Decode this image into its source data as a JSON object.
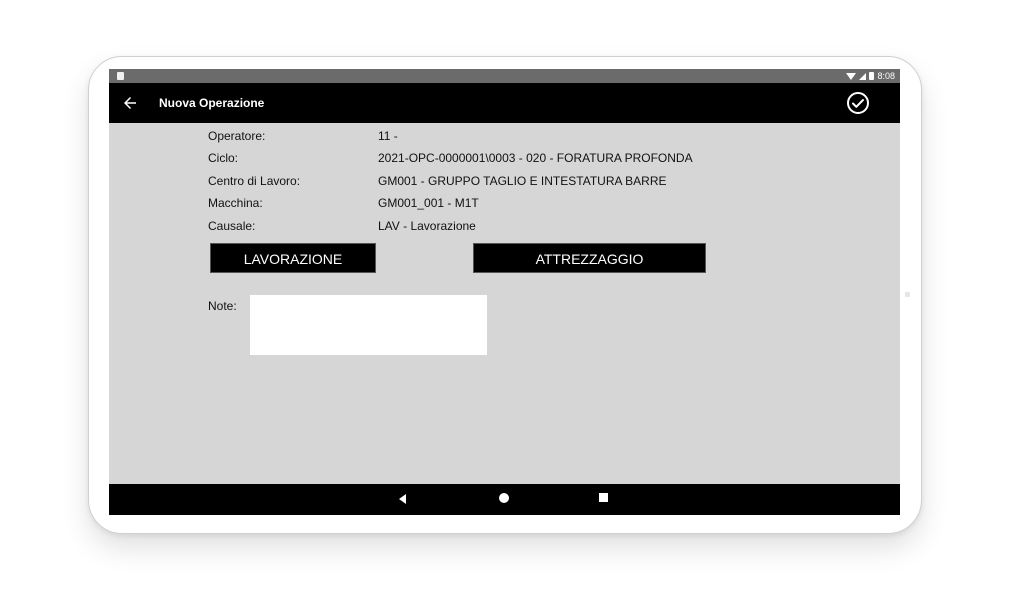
{
  "status_bar": {
    "time": "8:08",
    "icons": [
      "sim-icon",
      "wifi-icon",
      "signal-icon",
      "battery-icon"
    ]
  },
  "app_bar": {
    "title": "Nuova Operazione",
    "back_icon": "arrow-left-icon",
    "confirm_icon": "check-circle-icon"
  },
  "fields": [
    {
      "label": "Operatore:",
      "value": "11 -"
    },
    {
      "label": "Ciclo:",
      "value": "2021-OPC-0000001\\0003 - 020 - FORATURA PROFONDA"
    },
    {
      "label": "Centro di Lavoro:",
      "value": "GM001 - GRUPPO TAGLIO E INTESTATURA BARRE"
    },
    {
      "label": "Macchina:",
      "value": "GM001_001 - M1T"
    },
    {
      "label": "Causale:",
      "value": "LAV - Lavorazione"
    }
  ],
  "buttons": {
    "lavorazione": "LAVORAZIONE",
    "attrezzaggio": "ATTREZZAGGIO"
  },
  "note": {
    "label": "Note:",
    "value": ""
  },
  "nav_bar": {
    "icons": [
      "nav-back-icon",
      "nav-home-icon",
      "nav-recents-icon"
    ]
  },
  "colors": {
    "screen_bg": "#d6d6d6",
    "bar_bg": "#000000",
    "status_bg": "#6b6b6b",
    "text": "#111111"
  }
}
